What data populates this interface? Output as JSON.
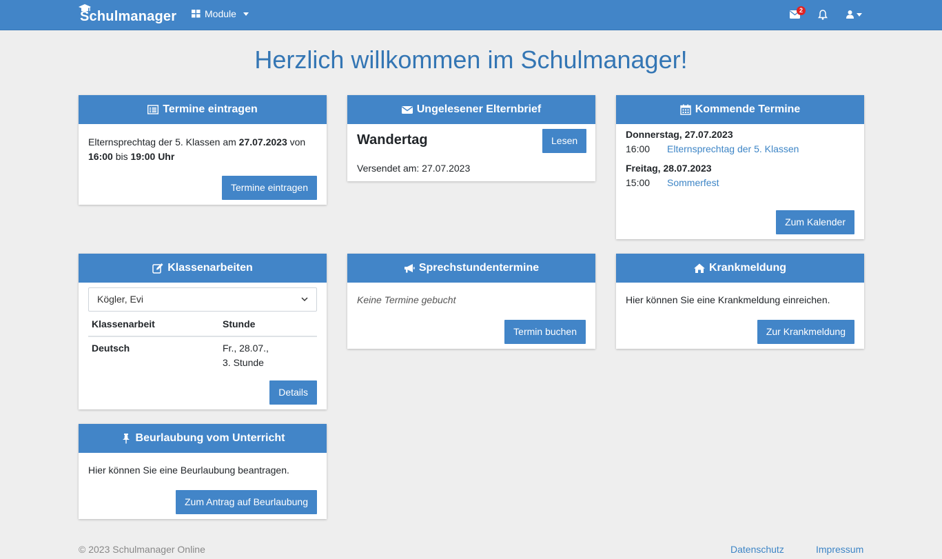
{
  "navbar": {
    "brand": "Schulmanager",
    "module_label": "Module",
    "mail_badge": "2"
  },
  "page_title": "Herzlich willkommen im Schulmanager!",
  "termine_eintragen": {
    "header": "Termine eintragen",
    "text_1": "Elternsprechtag der 5. Klassen am ",
    "date": "27.07.2023",
    "text_2": " von",
    "start": "16:00",
    "text_3": " bis ",
    "end": "19:00 Uhr",
    "button": "Termine eintragen"
  },
  "elternbrief": {
    "header": "Ungelesener Elternbrief",
    "title": "Wandertag",
    "button": "Lesen",
    "sent": "Versendet am: 27.07.2023"
  },
  "kommende_termine": {
    "header": "Kommende Termine",
    "days": [
      {
        "day": "Donnerstag, 27.07.2023",
        "time": "16:00",
        "event": "Elternsprechtag der 5. Klassen"
      },
      {
        "day": "Freitag, 28.07.2023",
        "time": "15:00",
        "event": "Sommerfest"
      }
    ],
    "button": "Zum Kalender"
  },
  "klassenarbeiten": {
    "header": "Klassenarbeiten",
    "student": "Kögler, Evi",
    "columns": [
      "Klassenarbeit",
      "Stunde"
    ],
    "rows": [
      {
        "subject": "Deutsch",
        "date": "Fr., 28.07.,",
        "lesson": "3. Stunde"
      }
    ],
    "button": "Details"
  },
  "sprechstunden": {
    "header": "Sprechstundentermine",
    "empty": "Keine Termine gebucht",
    "button": "Termin buchen"
  },
  "krankmeldung": {
    "header": "Krankmeldung",
    "text": "Hier können Sie eine Krankmeldung einreichen.",
    "button": "Zur Krankmeldung"
  },
  "beurlaubung": {
    "header": "Beurlaubung vom Unterricht",
    "text": "Hier können Sie eine Beurlaubung beantragen.",
    "button": "Zum Antrag auf Beurlaubung"
  },
  "footer": {
    "copyright": "© 2023 Schulmanager Online",
    "privacy": "Datenschutz",
    "imprint": "Impressum"
  },
  "colors": {
    "primary": "#4285c8",
    "title": "#3476b4",
    "background": "#eeeeee",
    "badge": "#e02424"
  }
}
